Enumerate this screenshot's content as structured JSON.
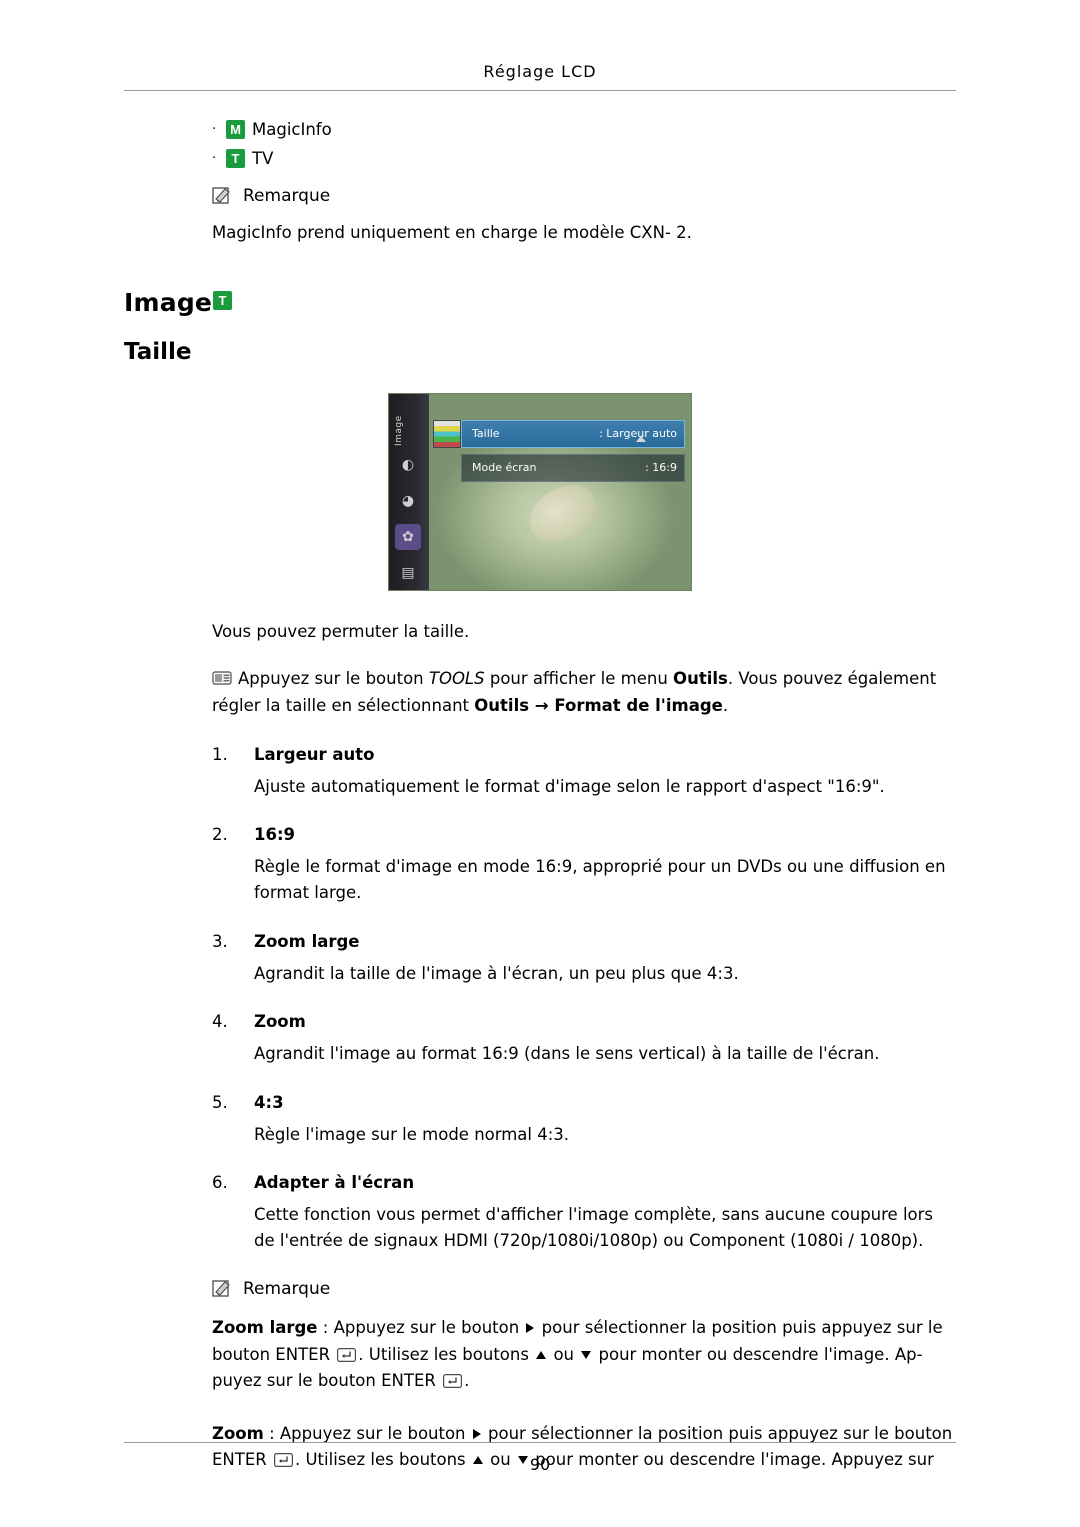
{
  "header": {
    "title": "Réglage LCD"
  },
  "footer": {
    "page_number": "90"
  },
  "bullets": [
    {
      "tag": "M",
      "label": "MagicInfo",
      "tag_color": "#1b9c3c"
    },
    {
      "tag": "T",
      "label": "TV",
      "tag_color": "#1b9c3c"
    }
  ],
  "note1": {
    "icon": "note-pencil-icon",
    "label": "Remarque",
    "text": "MagicInfo prend uniquement en charge le modèle CXN- 2."
  },
  "section": {
    "title": "Image",
    "title_tag": "T",
    "subtitle": "Taille"
  },
  "osd": {
    "left_label": "Image",
    "rows": [
      {
        "label": "Taille",
        "value": ": Largeur auto",
        "highlight": true
      },
      {
        "label": "Mode écran",
        "value": ": 16:9",
        "highlight": false
      }
    ]
  },
  "intro": "Vous pouvez permuter la taille.",
  "tools_para": {
    "icon": "tools-icon",
    "text_a": "Appuyez sur le bouton ",
    "text_b": "TOOLS",
    "text_c": " pour afficher le menu ",
    "text_d": "Outils",
    "text_e": ". Vous pouvez également régler la taille en sélectionnant ",
    "text_f": "Outils",
    "text_g": " → ",
    "text_h": "Format de l'image",
    "text_i": "."
  },
  "items": [
    {
      "num": "1.",
      "title": "Largeur auto",
      "body": "Ajuste automatiquement le format d'image selon le rapport d'aspect \"16:9\"."
    },
    {
      "num": "2.",
      "title": "16:9",
      "body": "Règle le format d'image en mode 16:9, approprié pour un DVDs ou une diffusion en format large."
    },
    {
      "num": "3.",
      "title": "Zoom large",
      "body": "Agrandit la taille de l'image à l'écran, un peu plus que 4:3."
    },
    {
      "num": "4.",
      "title": "Zoom",
      "body": "Agrandit l'image au format 16:9 (dans le sens vertical) à la taille de l'écran."
    },
    {
      "num": "5.",
      "title": "4:3",
      "body": "Règle l'image sur le mode normal 4:3."
    },
    {
      "num": "6.",
      "title": "Adapter à l'écran",
      "body": "Cette fonction vous permet d'afficher l'image complète, sans aucune coupure lors de l'entrée de signaux HDMI (720p/1080i/1080p) ou Component (1080i / 1080p)."
    }
  ],
  "note2": {
    "icon": "note-pencil-icon",
    "label": "Remarque",
    "para1": {
      "lead": "Zoom large",
      "t1": " : Appuyez sur le bouton ",
      "t2": " pour sélectionner la position puis appuyez sur le bouton ENTER ",
      "t3": ". Utilisez les boutons ",
      "t4": " ou ",
      "t5": " pour monter ou descendre l'image. Ap-puyez sur le bouton ENTER ",
      "t6": "."
    },
    "para2": {
      "lead": "Zoom",
      "t1": " : Appuyez sur le bouton ",
      "t2": " pour sélectionner la position puis appuyez sur le bouton ENTER ",
      "t3": ". Utilisez les boutons ",
      "t4": " ou ",
      "t5": " pour monter ou descendre l'image. Appuyez sur"
    }
  }
}
